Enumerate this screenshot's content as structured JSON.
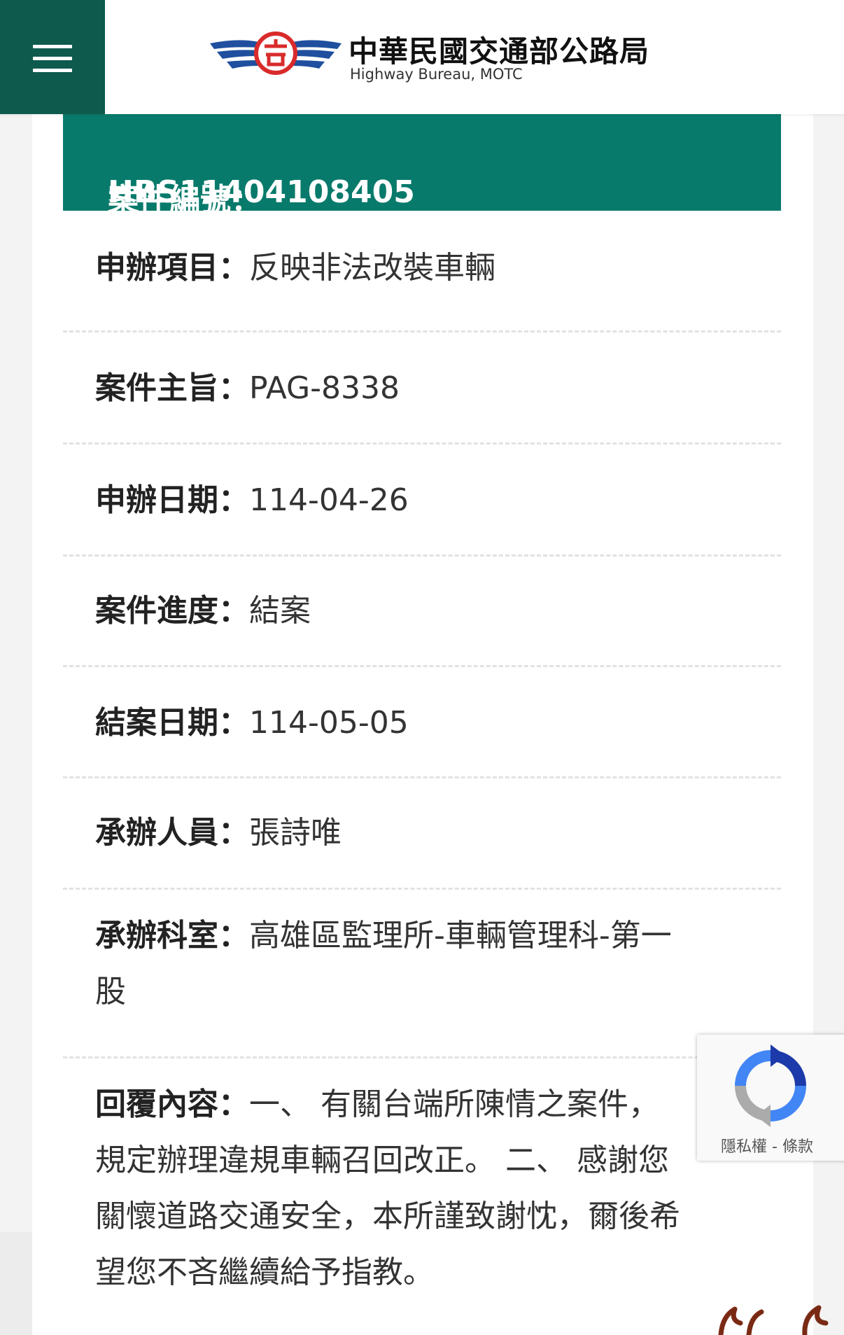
{
  "header": {
    "logo_title": "中華民國交通部公路局",
    "logo_subtitle": "Highway Bureau, MOTC"
  },
  "case": {
    "number_label": "案件編號：",
    "number": "HBS11404108405"
  },
  "details": [
    {
      "label": "申辦項目：",
      "value": "反映非法改裝車輛"
    },
    {
      "label": "案件主旨：",
      "value": "PAG-8338"
    },
    {
      "label": "申辦日期：",
      "value": "114-04-26"
    },
    {
      "label": "案件進度：",
      "value": "結案"
    },
    {
      "label": "結案日期：",
      "value": "114-05-05"
    },
    {
      "label": "承辦人員：",
      "value": "張詩唯"
    },
    {
      "label": "承辦科室：",
      "value_line1": "高雄區監理所-車輛管理科-第一",
      "value_line2": "股"
    },
    {
      "label": "回覆內容：",
      "line1": "一、 有關台端所陳情之案件，",
      "line2": "規定辦理違規車輛召回改正。 二、 感謝您",
      "line3": "關懷道路交通安全，本所謹致謝忱，爾後希",
      "line4": "望您不吝繼續給予指教。"
    }
  ],
  "recaptcha": {
    "privacy_label": "隱私權",
    "separator": " - ",
    "terms_label": "條款"
  },
  "colors": {
    "menu_bg": "#0e5a4d",
    "banner_bg": "#087a6b"
  }
}
